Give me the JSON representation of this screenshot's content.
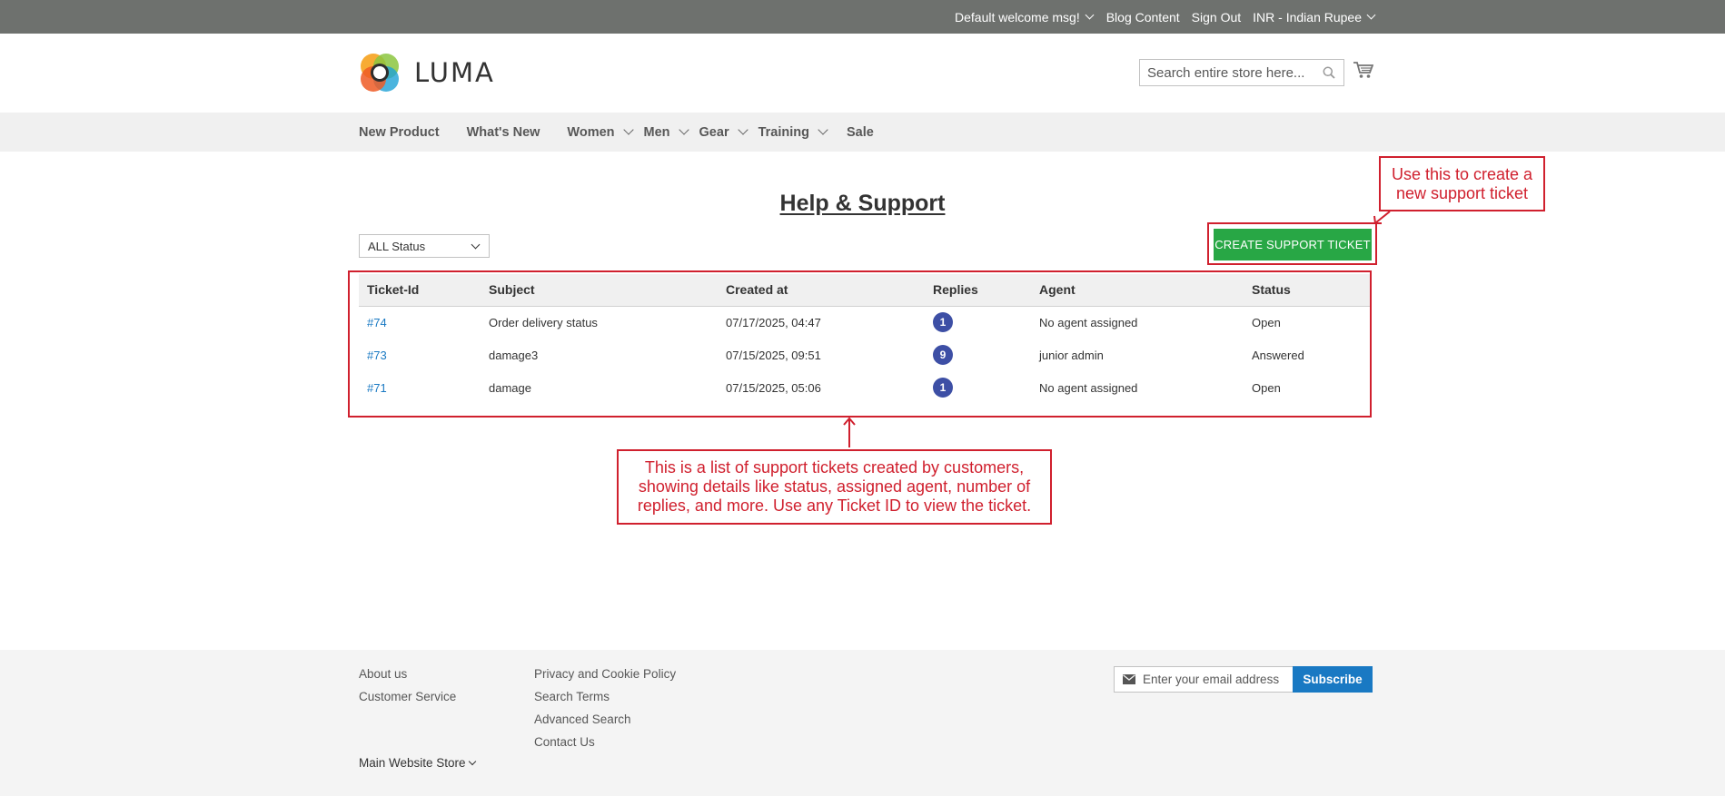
{
  "topbar": {
    "welcome": "Default welcome msg!",
    "blog": "Blog Content",
    "signout": "Sign Out",
    "currency": "INR - Indian Rupee"
  },
  "header": {
    "logo_text": "LUMA",
    "search_placeholder": "Search entire store here...",
    "search_value": ""
  },
  "nav": {
    "items": [
      {
        "label": "New Product",
        "has_dropdown": false
      },
      {
        "label": "What's New",
        "has_dropdown": false
      },
      {
        "label": "Women",
        "has_dropdown": true
      },
      {
        "label": "Men",
        "has_dropdown": true
      },
      {
        "label": "Gear",
        "has_dropdown": true
      },
      {
        "label": "Training",
        "has_dropdown": true
      },
      {
        "label": "Sale",
        "has_dropdown": false
      }
    ]
  },
  "main": {
    "title": "Help & Support",
    "status_filter": "ALL Status",
    "create_button": "CREATE SUPPORT TICKET",
    "table": {
      "headers": [
        "Ticket-Id",
        "Subject",
        "Created at",
        "Replies",
        "Agent",
        "Status"
      ],
      "rows": [
        {
          "id": "#74",
          "subject": "Order delivery status",
          "created": "07/17/2025, 04:47",
          "replies": "1",
          "agent": "No agent assigned",
          "status": "Open"
        },
        {
          "id": "#73",
          "subject": "damage3",
          "created": "07/15/2025, 09:51",
          "replies": "9",
          "agent": "junior admin",
          "status": "Answered"
        },
        {
          "id": "#71",
          "subject": "damage",
          "created": "07/15/2025, 05:06",
          "replies": "1",
          "agent": "No agent assigned",
          "status": "Open"
        }
      ]
    }
  },
  "annotations": {
    "create_note": "Use this to create a new support ticket",
    "list_note": "This is a list of support tickets created by customers, showing details like status, assigned agent, number of replies, and more. Use any Ticket ID to view the ticket.",
    "color": "#d0202e"
  },
  "footer": {
    "col1": [
      "About us",
      "Customer Service"
    ],
    "col2": [
      "Privacy and Cookie Policy",
      "Search Terms",
      "Advanced Search",
      "Contact Us"
    ],
    "store": "Main Website Store",
    "newsletter_placeholder": "Enter your email address",
    "subscribe": "Subscribe"
  },
  "colors": {
    "topbar": "#6e716e",
    "nav_bg": "#f0f0f0",
    "create_button": "#28a745",
    "link": "#1979c3",
    "badge": "#3d4fa5",
    "subscribe": "#1979c3"
  }
}
